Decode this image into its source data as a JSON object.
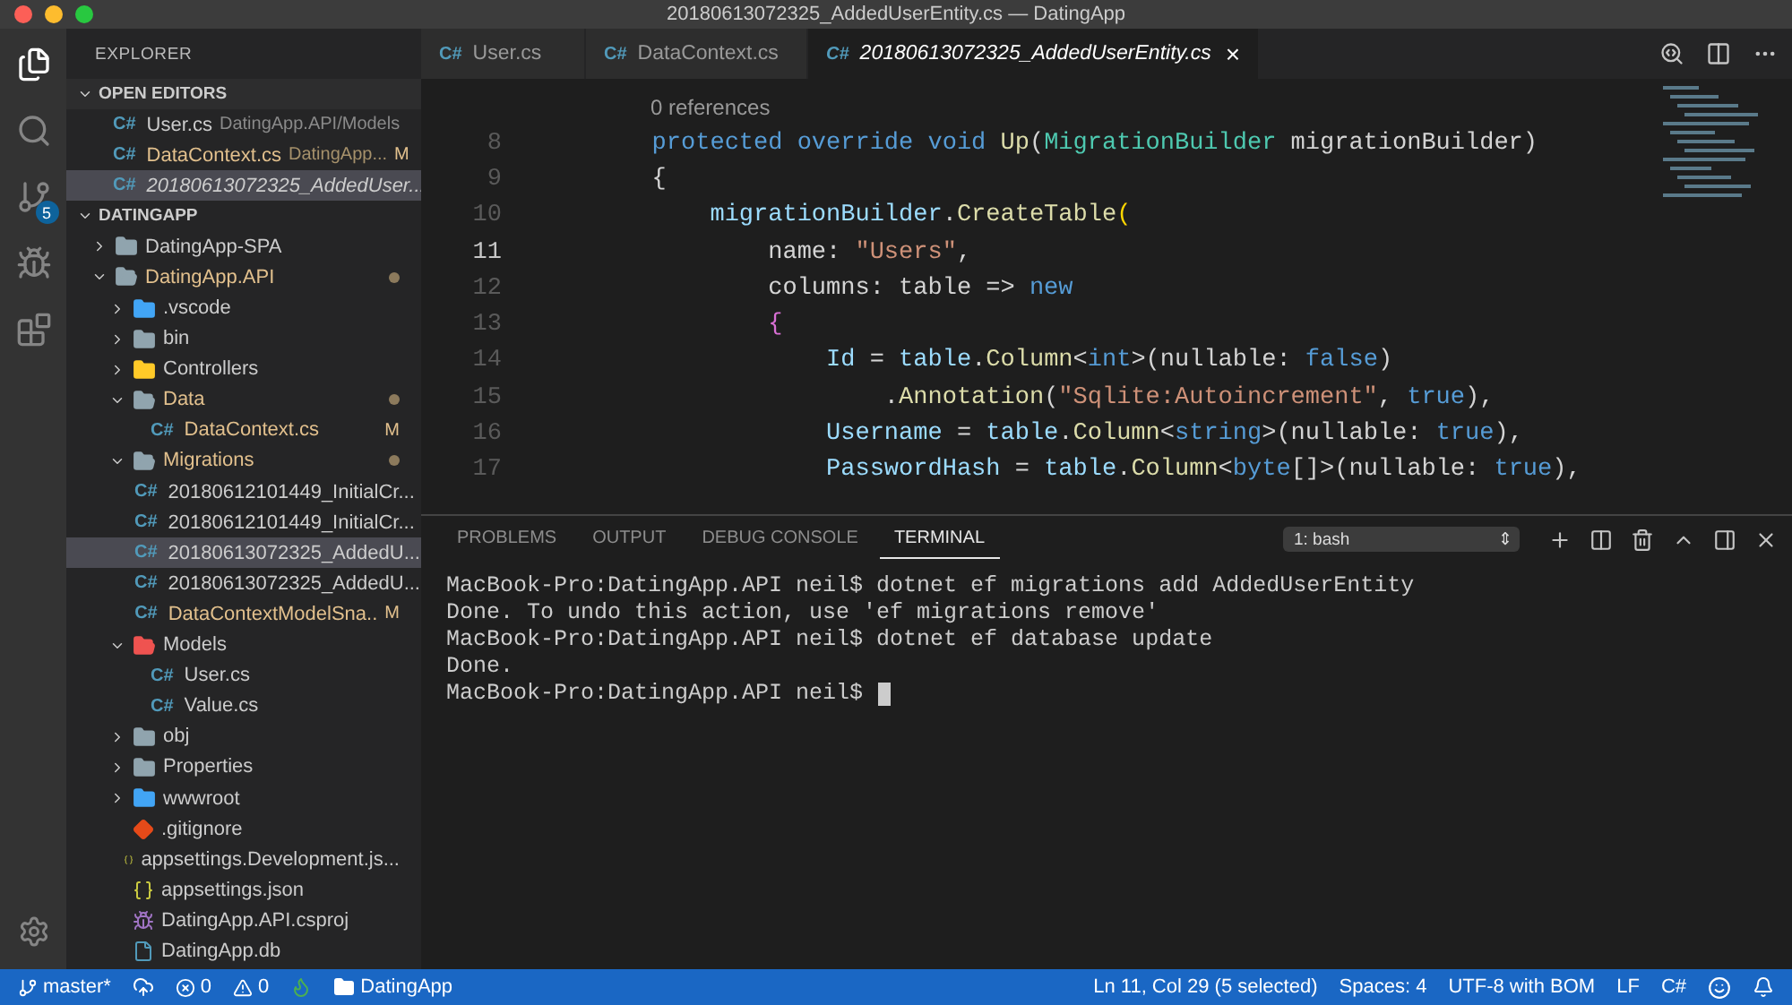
{
  "window": {
    "title": "20180613072325_AddedUserEntity.cs — DatingApp"
  },
  "activity_bar": {
    "items": [
      {
        "kind": "files",
        "selected": true
      },
      {
        "kind": "search",
        "selected": false
      },
      {
        "kind": "scm",
        "selected": false,
        "badge": "5"
      },
      {
        "kind": "debug",
        "selected": false
      },
      {
        "kind": "extensions",
        "selected": false
      }
    ]
  },
  "sidebar": {
    "title": "EXPLORER",
    "open_editors": {
      "title": "OPEN EDITORS",
      "expanded": true,
      "items": [
        {
          "icon": "C#",
          "name": "User.cs",
          "path": "DatingApp.API/Models",
          "modified": false,
          "italic": false,
          "selected": false
        },
        {
          "icon": "C#",
          "name": "DataContext.cs",
          "path": "DatingApp...",
          "modified": true,
          "badge": "M",
          "italic": false,
          "selected": false
        },
        {
          "icon": "C#",
          "name": "20180613072325_AddedUser...",
          "modified": false,
          "italic": true,
          "selected": true
        }
      ]
    },
    "folder": {
      "title": "DATINGAPP",
      "expanded": true,
      "items": [
        {
          "name": "DatingApp-SPA",
          "kind": "folder",
          "expanded": false,
          "modified": false,
          "selected": false
        },
        {
          "name": "DatingApp.API",
          "kind": "folder",
          "expanded": true,
          "modified": true,
          "selected": false,
          "children": [
            {
              "name": ".vscode",
              "kind": "vscode-folder",
              "expanded": false,
              "modified": false,
              "selected": false
            },
            {
              "name": "bin",
              "kind": "folder",
              "expanded": false,
              "modified": false,
              "selected": false
            },
            {
              "name": "Controllers",
              "kind": "controllers-folder",
              "expanded": false,
              "modified": false,
              "selected": false
            },
            {
              "name": "Data",
              "kind": "folder",
              "expanded": true,
              "modified": true,
              "selected": false,
              "children": [
                {
                  "icon": "C#",
                  "name": "DataContext.cs",
                  "kind": "csharp",
                  "modified": true,
                  "badge": "M",
                  "selected": false
                }
              ]
            },
            {
              "name": "Migrations",
              "kind": "folder",
              "expanded": true,
              "modified": true,
              "selected": false,
              "children": [
                {
                  "icon": "C#",
                  "name": "20180612101449_InitialCr...",
                  "kind": "csharp",
                  "modified": false,
                  "selected": false
                },
                {
                  "icon": "C#",
                  "name": "20180612101449_InitialCr...",
                  "kind": "csharp",
                  "modified": false,
                  "selected": false
                },
                {
                  "icon": "C#",
                  "name": "20180613072325_AddedU...",
                  "kind": "csharp",
                  "modified": false,
                  "selected": true
                },
                {
                  "icon": "C#",
                  "name": "20180613072325_AddedU...",
                  "kind": "csharp",
                  "modified": false,
                  "selected": false
                },
                {
                  "icon": "C#",
                  "name": "DataContextModelSna..",
                  "kind": "csharp",
                  "modified": true,
                  "badge": "M",
                  "selected": false
                }
              ]
            },
            {
              "name": "Models",
              "kind": "models-folder",
              "expanded": true,
              "modified": false,
              "selected": false,
              "children": [
                {
                  "icon": "C#",
                  "name": "User.cs",
                  "kind": "csharp",
                  "modified": false,
                  "selected": false
                },
                {
                  "icon": "C#",
                  "name": "Value.cs",
                  "kind": "csharp",
                  "modified": false,
                  "selected": false
                }
              ]
            },
            {
              "name": "obj",
              "kind": "folder",
              "expanded": false,
              "modified": false,
              "selected": false
            },
            {
              "name": "Properties",
              "kind": "folder",
              "expanded": false,
              "modified": false,
              "selected": false
            },
            {
              "name": "wwwroot",
              "kind": "web-folder",
              "expanded": false,
              "modified": false,
              "selected": false
            },
            {
              "name": ".gitignore",
              "kind": "git",
              "modified": false,
              "selected": false
            },
            {
              "name": "appsettings.Development.js...",
              "kind": "json",
              "modified": false,
              "selected": false
            },
            {
              "name": "appsettings.json",
              "kind": "json",
              "modified": false,
              "selected": false
            },
            {
              "name": "DatingApp.API.csproj",
              "kind": "csproj",
              "modified": false,
              "selected": false
            },
            {
              "name": "DatingApp.db",
              "kind": "file",
              "modified": false,
              "selected": false
            }
          ]
        }
      ]
    }
  },
  "tabs": [
    {
      "icon": "C#",
      "label": "User.cs",
      "selected": false,
      "italic": false
    },
    {
      "icon": "C#",
      "label": "DataContext.cs",
      "selected": false,
      "italic": false
    },
    {
      "icon": "C#",
      "label": "20180613072325_AddedUserEntity.cs",
      "selected": true,
      "italic": true,
      "close": "×"
    }
  ],
  "editor": {
    "codelens": "0 references",
    "lines": [
      {
        "number": "8",
        "current": false,
        "tokens": [
          {
            "text": "        protected override void ",
            "kind": "keyword"
          },
          {
            "text": "Up",
            "kind": "method"
          },
          {
            "text": "(",
            "kind": "plain"
          },
          {
            "text": "MigrationBuilder",
            "kind": "type"
          },
          {
            "text": " migrationBuilder)",
            "kind": "plain"
          }
        ]
      },
      {
        "number": "9",
        "current": false,
        "tokens": [
          {
            "text": "        {",
            "kind": "plain"
          }
        ]
      },
      {
        "number": "10",
        "current": false,
        "tokens": [
          {
            "text": "            migrationBuilder",
            "kind": "variable"
          },
          {
            "text": ".",
            "kind": "plain"
          },
          {
            "text": "CreateTable",
            "kind": "method"
          },
          {
            "text": "(",
            "kind": "bracket"
          }
        ]
      },
      {
        "number": "11",
        "current": true,
        "tokens": [
          {
            "text": "                name: ",
            "kind": "plain"
          },
          {
            "text": "\"Users\"",
            "kind": "string"
          },
          {
            "text": ",",
            "kind": "plain"
          }
        ]
      },
      {
        "number": "12",
        "current": false,
        "tokens": [
          {
            "text": "                columns: table => ",
            "kind": "plain"
          },
          {
            "text": "new",
            "kind": "keyword"
          }
        ]
      },
      {
        "number": "13",
        "current": false,
        "tokens": [
          {
            "text": "                {",
            "kind": "brace"
          }
        ]
      },
      {
        "number": "14",
        "current": false,
        "tokens": [
          {
            "text": "                    Id",
            "kind": "variable"
          },
          {
            "text": " = ",
            "kind": "plain"
          },
          {
            "text": "table",
            "kind": "variable"
          },
          {
            "text": ".",
            "kind": "plain"
          },
          {
            "text": "Column",
            "kind": "method"
          },
          {
            "text": "<",
            "kind": "plain"
          },
          {
            "text": "int",
            "kind": "keyword"
          },
          {
            "text": ">(nullable: ",
            "kind": "plain"
          },
          {
            "text": "false",
            "kind": "keyword"
          },
          {
            "text": ")",
            "kind": "plain"
          }
        ]
      },
      {
        "number": "15",
        "current": false,
        "tokens": [
          {
            "text": "                        .",
            "kind": "plain"
          },
          {
            "text": "Annotation",
            "kind": "method"
          },
          {
            "text": "(",
            "kind": "plain"
          },
          {
            "text": "\"Sqlite:Autoincrement\"",
            "kind": "string"
          },
          {
            "text": ", ",
            "kind": "plain"
          },
          {
            "text": "true",
            "kind": "keyword"
          },
          {
            "text": "),",
            "kind": "plain"
          }
        ]
      },
      {
        "number": "16",
        "current": false,
        "tokens": [
          {
            "text": "                    Username",
            "kind": "variable"
          },
          {
            "text": " = ",
            "kind": "plain"
          },
          {
            "text": "table",
            "kind": "variable"
          },
          {
            "text": ".",
            "kind": "plain"
          },
          {
            "text": "Column",
            "kind": "method"
          },
          {
            "text": "<",
            "kind": "plain"
          },
          {
            "text": "string",
            "kind": "keyword"
          },
          {
            "text": ">(nullable: ",
            "kind": "plain"
          },
          {
            "text": "true",
            "kind": "keyword"
          },
          {
            "text": "),",
            "kind": "plain"
          }
        ]
      },
      {
        "number": "17",
        "current": false,
        "tokens": [
          {
            "text": "                    PasswordHash",
            "kind": "variable"
          },
          {
            "text": " = ",
            "kind": "plain"
          },
          {
            "text": "table",
            "kind": "variable"
          },
          {
            "text": ".",
            "kind": "plain"
          },
          {
            "text": "Column",
            "kind": "method"
          },
          {
            "text": "<",
            "kind": "plain"
          },
          {
            "text": "byte",
            "kind": "keyword"
          },
          {
            "text": "[]>(nullable: ",
            "kind": "plain"
          },
          {
            "text": "true",
            "kind": "keyword"
          },
          {
            "text": "),",
            "kind": "plain"
          }
        ]
      }
    ]
  },
  "panel": {
    "tabs": [
      {
        "label": "PROBLEMS",
        "selected": false
      },
      {
        "label": "OUTPUT",
        "selected": false
      },
      {
        "label": "DEBUG CONSOLE",
        "selected": false
      },
      {
        "label": "TERMINAL",
        "selected": true
      }
    ],
    "terminal_select": "1: bash",
    "arrows": "⇕",
    "terminal_lines": [
      "MacBook-Pro:DatingApp.API neil$ dotnet ef migrations add AddedUserEntity",
      "Done. To undo this action, use 'ef migrations remove'",
      "MacBook-Pro:DatingApp.API neil$ dotnet ef database update",
      "Done.",
      "MacBook-Pro:DatingApp.API neil$"
    ]
  },
  "status_bar": {
    "left": [
      {
        "kind": "branch",
        "text": "master*"
      },
      {
        "kind": "sync"
      },
      {
        "kind": "errors",
        "text": "0"
      },
      {
        "kind": "warnings",
        "text": "0"
      },
      {
        "kind": "flame"
      },
      {
        "kind": "folder",
        "text": "DatingApp"
      }
    ],
    "right": [
      {
        "kind": "text",
        "text": "Ln 11, Col 29 (5 selected)"
      },
      {
        "kind": "text",
        "text": "Spaces: 4"
      },
      {
        "kind": "text",
        "text": "UTF-8 with BOM"
      },
      {
        "kind": "text",
        "text": "LF"
      },
      {
        "kind": "text",
        "text": "C#"
      },
      {
        "kind": "smiley"
      },
      {
        "kind": "bell"
      }
    ]
  }
}
